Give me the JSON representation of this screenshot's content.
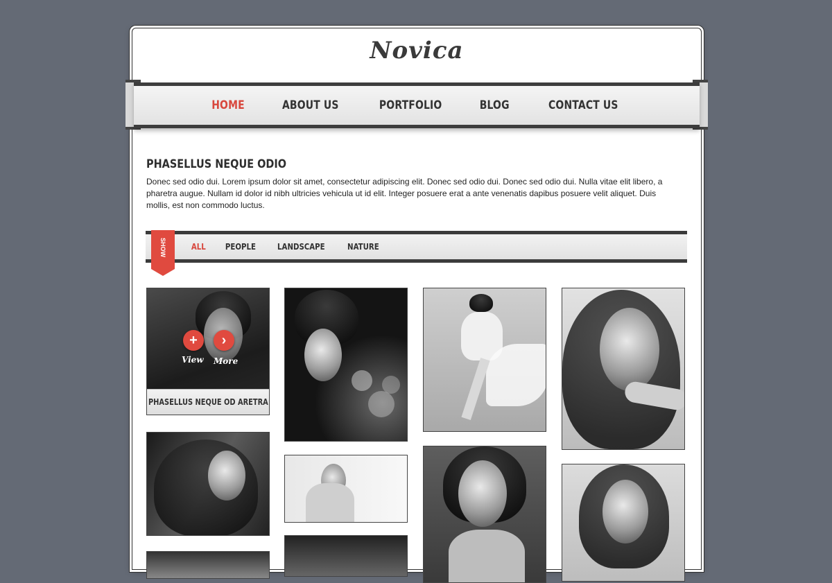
{
  "site": {
    "logo": "Novica"
  },
  "nav": {
    "items": [
      {
        "label": "HOME",
        "active": true
      },
      {
        "label": "ABOUT US",
        "active": false
      },
      {
        "label": "PORTFOLIO",
        "active": false
      },
      {
        "label": "BLOG",
        "active": false
      },
      {
        "label": "CONTACT US",
        "active": false
      }
    ]
  },
  "intro": {
    "title": "PHASELLUS NEQUE ODIO",
    "text": "Donec sed odio dui. Lorem ipsum dolor sit amet, consectetur adipiscing elit. Donec sed odio dui. Donec sed odio dui. Nulla vitae elit libero, a pharetra augue. Nullam id dolor id nibh ultricies vehicula ut id elit. Integer posuere erat a ante venenatis dapibus posuere velit aliquet. Duis mollis, est non commodo luctus."
  },
  "filter": {
    "show_label": "SHOW",
    "options": [
      {
        "label": "ALL",
        "active": true
      },
      {
        "label": "PEOPLE",
        "active": false
      },
      {
        "label": "LANDSCAPE",
        "active": false
      },
      {
        "label": "NATURE",
        "active": false
      }
    ]
  },
  "gallery": {
    "featured_caption": "PHASELLUS NEQUE OD ARETRA",
    "view_label": "View",
    "more_label": "More"
  },
  "colors": {
    "accent": "#e04a3f",
    "background": "#646a75",
    "text": "#333333"
  }
}
